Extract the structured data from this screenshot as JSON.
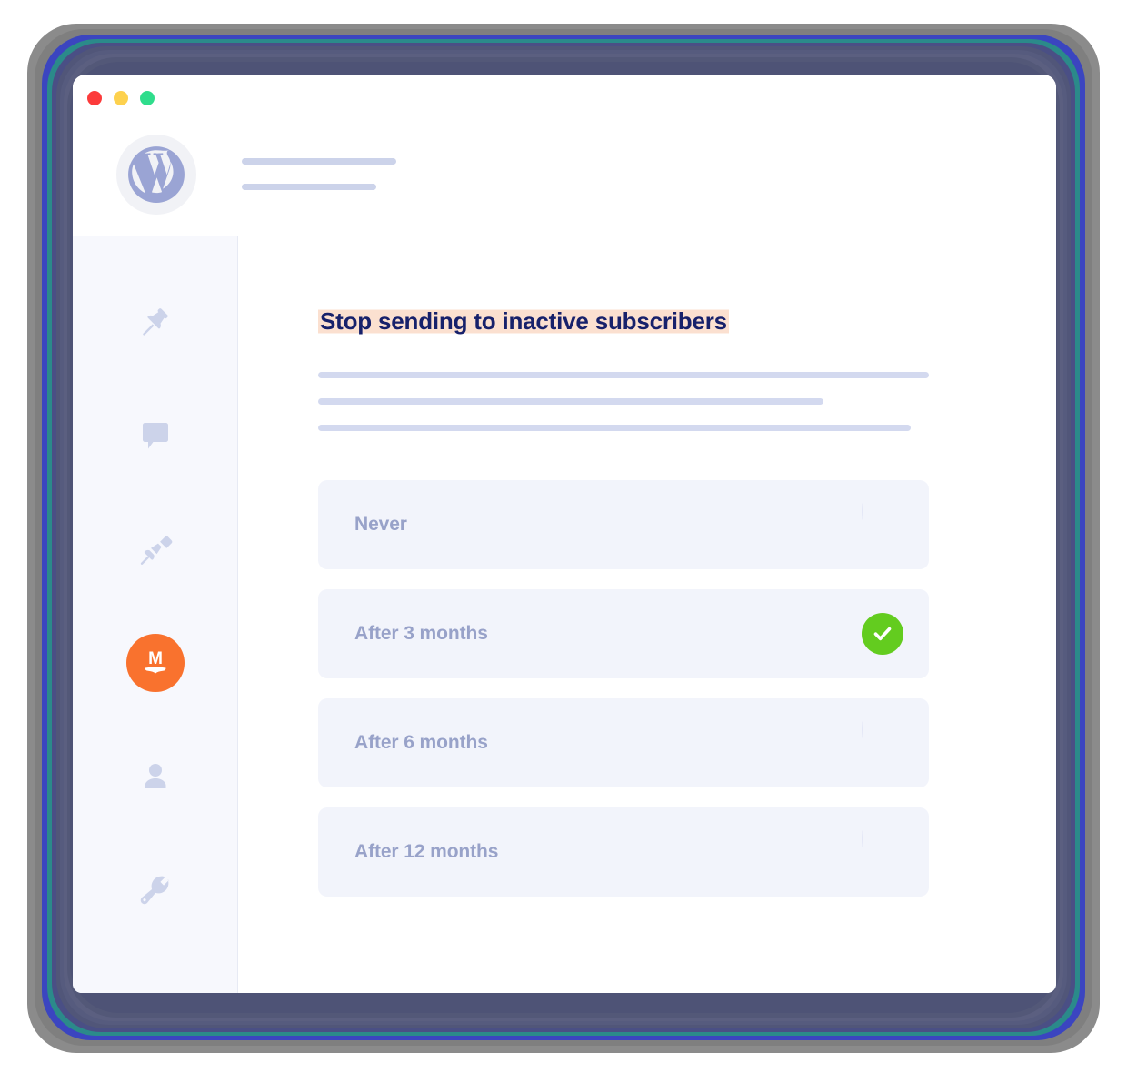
{
  "window": {
    "traffic_lights": [
      {
        "name": "close",
        "color": "#fc3b3b"
      },
      {
        "name": "minimize",
        "color": "#fdd14e"
      },
      {
        "name": "maximize",
        "color": "#2fdd8c"
      }
    ]
  },
  "header": {
    "logo_icon": "wordpress-icon",
    "placeholder_lines": 2
  },
  "sidebar": {
    "items": [
      {
        "icon": "pushpin-icon",
        "name": "sidebar-item-posts",
        "active": false
      },
      {
        "icon": "comment-icon",
        "name": "sidebar-item-comments",
        "active": false
      },
      {
        "icon": "paintbrush-icon",
        "name": "sidebar-item-appearance",
        "active": false
      },
      {
        "icon": "mailpoet-icon",
        "name": "sidebar-item-mailpoet",
        "active": true,
        "badge_letter": "M"
      },
      {
        "icon": "user-icon",
        "name": "sidebar-item-users",
        "active": false
      },
      {
        "icon": "wrench-icon",
        "name": "sidebar-item-tools",
        "active": false
      }
    ]
  },
  "main": {
    "title": "Stop sending to inactive subscribers",
    "description_line_widths": [
      672,
      556,
      652
    ],
    "options": [
      {
        "label": "Never",
        "selected": false
      },
      {
        "label": "After 3 months",
        "selected": true
      },
      {
        "label": "After 6 months",
        "selected": false
      },
      {
        "label": "After 12 months",
        "selected": false
      }
    ]
  },
  "colors": {
    "accent_orange": "#f9722e",
    "selected_green": "#63cc1f",
    "title_navy": "#17216b",
    "highlight_peach": "#fbe0d0",
    "muted_text": "#98a2c9",
    "row_bg": "#f2f4fb",
    "sidebar_bg": "#f7f8fd",
    "wordpress_blue": "#9aa4d4"
  }
}
